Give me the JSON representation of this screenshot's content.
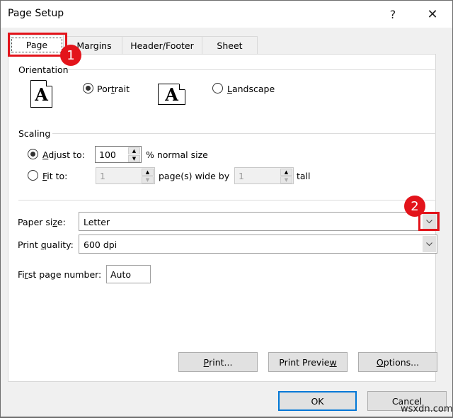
{
  "window": {
    "title": "Page Setup",
    "help_glyph": "?",
    "close_glyph": "✕"
  },
  "tabs": [
    {
      "label": "Page",
      "active": true
    },
    {
      "label": "Margins",
      "active": false
    },
    {
      "label": "Header/Footer",
      "active": false
    },
    {
      "label": "Sheet",
      "active": false
    }
  ],
  "annotations": {
    "badge1": "1",
    "badge2": "2",
    "highlight_color": "#e3141b"
  },
  "orientation": {
    "label": "Orientation",
    "icon_glyph": "A",
    "portrait": {
      "pre": "Por",
      "accel": "t",
      "post": "rait",
      "checked": true
    },
    "landscape": {
      "pre": "",
      "accel": "L",
      "post": "andscape",
      "checked": false
    }
  },
  "scaling": {
    "label": "Scaling",
    "adjust": {
      "accel": "A",
      "post": "djust to:",
      "checked": true,
      "value": "100",
      "suffix": "% normal size"
    },
    "fit": {
      "accel": "F",
      "post": "it to:",
      "checked": false,
      "wide_value": "1",
      "wide_suffix": "page(s) wide by",
      "tall_value": "1",
      "tall_suffix": "tall"
    }
  },
  "paper_size": {
    "pre": "Paper si",
    "accel": "z",
    "post": "e:",
    "value": "Letter"
  },
  "print_quality": {
    "pre": "Print ",
    "accel": "q",
    "post": "uality:",
    "value": "600 dpi"
  },
  "first_page": {
    "pre": "Fi",
    "accel": "r",
    "post": "st page number:",
    "value": "Auto"
  },
  "buttons": {
    "print": {
      "pre": "",
      "accel": "P",
      "post": "rint..."
    },
    "preview": {
      "pre": "Print Previe",
      "accel": "w",
      "post": ""
    },
    "options": {
      "pre": "",
      "accel": "O",
      "post": "ptions..."
    },
    "ok": "OK",
    "cancel": "Cancel"
  },
  "watermark": "wsxdn.com",
  "colors": {
    "accent": "#0078d7",
    "highlight": "#e3141b"
  }
}
